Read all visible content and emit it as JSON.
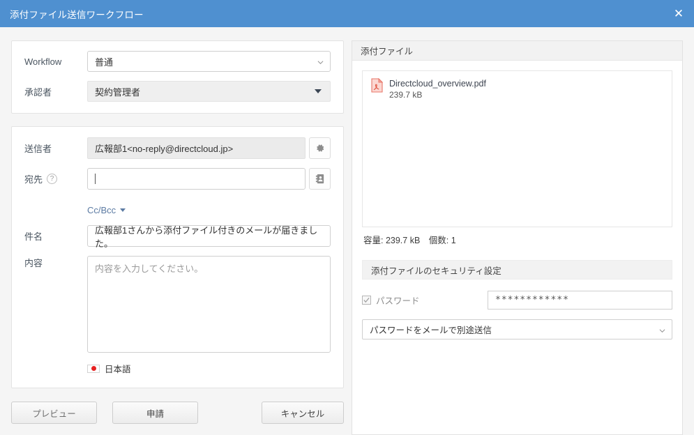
{
  "window": {
    "title": "添付ファイル送信ワークフロー",
    "close_label": "✕",
    "accent_color": "#4f90d0"
  },
  "workflow": {
    "label": "Workflow",
    "value": "普通",
    "approver_label": "承認者",
    "approver_value": "契約管理者"
  },
  "mail": {
    "sender_label": "送信者",
    "sender_value": "広報部1<no-reply@directcloud.jp>",
    "sender_settings_icon": "gear-icon",
    "to_label": "宛先",
    "to_help_icon": "?",
    "to_value": "",
    "to_placeholder": "",
    "address_book_icon": "address-book-icon",
    "ccbcc_label": "Cc/Bcc",
    "subject_label": "件名",
    "subject_value": "広報部1さんから添付ファイル付きのメールが届きました。",
    "content_label": "内容",
    "content_value": "",
    "content_placeholder": "内容を入力してください。",
    "language_label": "日本語",
    "language_flag": "japan-flag-icon"
  },
  "footer": {
    "preview_label": "プレビュー",
    "apply_label": "申請",
    "cancel_label": "キャンセル"
  },
  "attachments": {
    "panel_title": "添付ファイル",
    "files": [
      {
        "name": "Directcloud_overview.pdf",
        "size": "239.7 kB",
        "icon": "pdf-file-icon"
      }
    ],
    "summary": "容量: 239.7 kB　個数: 1"
  },
  "security": {
    "panel_title": "添付ファイルのセキュリティ設定",
    "password_checkbox_label": "パスワード",
    "password_checked": true,
    "password_value": "************",
    "delivery_option": "パスワードをメールで別途送信"
  }
}
